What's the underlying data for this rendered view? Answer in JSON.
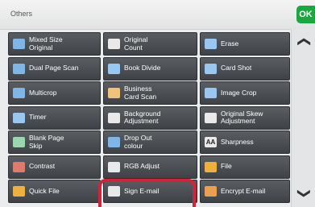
{
  "header": {
    "title": "Others",
    "ok_label": "OK"
  },
  "buttons": [
    [
      {
        "label": "Mixed Size\nOriginal",
        "icon": "mixed-size-icon",
        "color": "#7fb6e6"
      },
      {
        "label": "Original\nCount",
        "icon": "original-count-icon",
        "color": "#e9e9e9"
      },
      {
        "label": "Erase",
        "icon": "erase-icon",
        "color": "#9ac7f0"
      }
    ],
    [
      {
        "label": "Dual Page Scan",
        "icon": "dual-page-icon",
        "color": "#7fb6e6"
      },
      {
        "label": "Book Divide",
        "icon": "book-divide-icon",
        "color": "#9ac7f0"
      },
      {
        "label": "Card Shot",
        "icon": "card-shot-icon",
        "color": "#9ac7f0"
      }
    ],
    [
      {
        "label": "Multicrop",
        "icon": "multicrop-icon",
        "color": "#7fb6e6"
      },
      {
        "label": "Business\nCard Scan",
        "icon": "business-card-icon",
        "color": "#f0c27a"
      },
      {
        "label": "Image Crop",
        "icon": "image-crop-icon",
        "color": "#9ac7f0"
      }
    ],
    [
      {
        "label": "Timer",
        "icon": "timer-icon",
        "color": "#9ac7f0"
      },
      {
        "label": "Background\nAdjustment",
        "icon": "background-adjust-icon",
        "color": "#e9e9e9"
      },
      {
        "label": "Original Skew\nAdjustment",
        "icon": "skew-adjust-icon",
        "color": "#e9e9e9"
      }
    ],
    [
      {
        "label": "Blank Page\nSkip",
        "icon": "blank-page-skip-icon",
        "color": "#9ad7b0"
      },
      {
        "label": "Drop Out\ncolour",
        "icon": "drop-out-colour-icon",
        "color": "#7fb6e6"
      },
      {
        "label": "Sharpness",
        "icon": "sharpness-icon",
        "color": "#e9e9e9",
        "glyph": "AA"
      }
    ],
    [
      {
        "label": "Contrast",
        "icon": "contrast-icon",
        "color": "#e07a6a"
      },
      {
        "label": "RGB Adjust",
        "icon": "rgb-adjust-icon",
        "color": "#e9e9e9"
      },
      {
        "label": "File",
        "icon": "file-icon",
        "color": "#f0b040"
      }
    ],
    [
      {
        "label": "Quick File",
        "icon": "quick-file-icon",
        "color": "#f0b040"
      },
      {
        "label": "Sign E-mail",
        "icon": "sign-email-icon",
        "color": "#e9e9e9"
      },
      {
        "label": "Encrypt E-mail",
        "icon": "encrypt-email-icon",
        "color": "#e9a050"
      }
    ]
  ],
  "scroll": {
    "up_icon": "chevron-up-icon",
    "down_icon": "chevron-down-icon"
  },
  "highlight_color": "#d1243b"
}
